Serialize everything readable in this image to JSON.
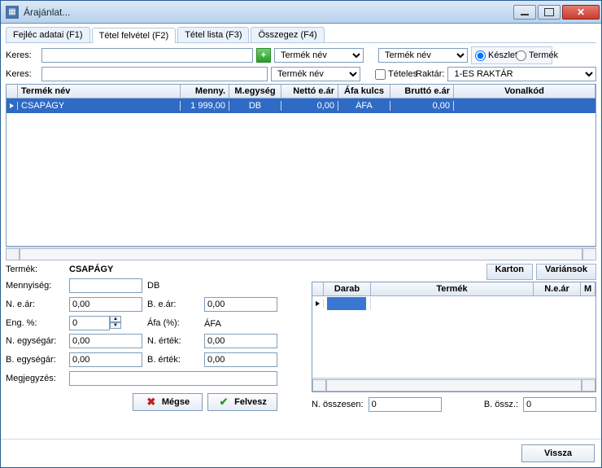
{
  "window": {
    "title": "Árajánlat..."
  },
  "tabs": [
    {
      "label": "Fejléc adatai (F1)"
    },
    {
      "label": "Tétel felvétel (F2)"
    },
    {
      "label": "Tétel lista (F3)"
    },
    {
      "label": "Összegez (F4)"
    }
  ],
  "active_tab": 1,
  "search": {
    "label": "Keres:",
    "value1": "",
    "value2": "",
    "combo1": "Termék név",
    "combo2": "Termék név",
    "combo3": "Termék név",
    "radio_stock": "Készlet",
    "radio_product": "Termék",
    "radio_selected": "Készlet",
    "itemized_label": "Tételes",
    "itemized_checked": false,
    "warehouse_label": "Raktár:",
    "warehouse_value": "1-ES RAKTÁR"
  },
  "main_table": {
    "columns": [
      "Termék név",
      "Menny.",
      "M.egység",
      "Nettó e.ár",
      "Áfa kulcs",
      "Bruttó e.ár",
      "Vonalkód"
    ],
    "rows": [
      {
        "name": "CSAPÁGY",
        "qty": "1 999,00",
        "unit": "DB",
        "net": "0,00",
        "vat": "ÁFA",
        "gross": "0,00",
        "barcode": ""
      }
    ],
    "selected_row": 0
  },
  "form": {
    "product_label": "Termék:",
    "product_value": "CSAPÁGY",
    "qty_label": "Mennyiség:",
    "qty_value": "",
    "unit": "DB",
    "net_label": "N. e.ár:",
    "net_value": "0,00",
    "gross_label": "B. e.ár:",
    "gross_value": "0,00",
    "disc_label": "Eng. %:",
    "disc_value": "0",
    "vat_label": "Áfa (%):",
    "vat_value": "ÁFA",
    "n_unit_label": "N. egységár:",
    "n_unit_value": "0,00",
    "n_val_label": "N. érték:",
    "n_val_value": "0,00",
    "b_unit_label": "B. egységár:",
    "b_unit_value": "0,00",
    "b_val_label": "B. érték:",
    "b_val_value": "0,00",
    "note_label": "Megjegyzés:",
    "note_value": "",
    "cancel": "Mégse",
    "submit": "Felvesz"
  },
  "right_buttons": {
    "karton": "Karton",
    "varians": "Variánsok"
  },
  "minigrid": {
    "columns": [
      "Darab",
      "Termék",
      "N.e.ár",
      "M"
    ]
  },
  "sums": {
    "n_label": "N. összesen:",
    "n_value": "0",
    "b_label": "B. össz.:",
    "b_value": "0"
  },
  "footer": {
    "back": "Vissza"
  }
}
